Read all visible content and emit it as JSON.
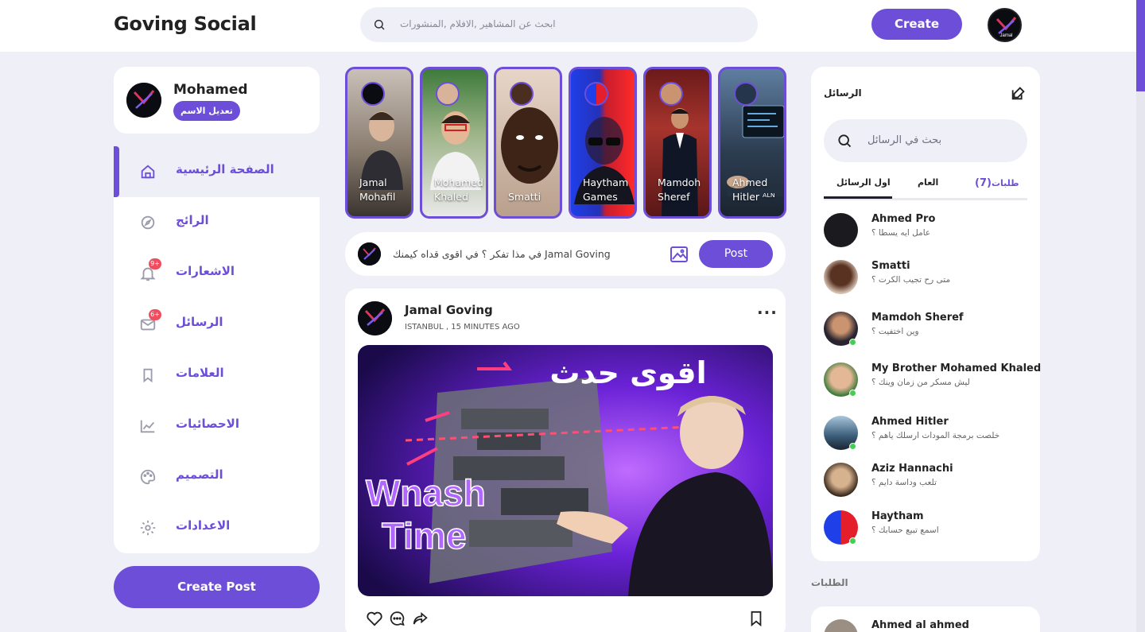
{
  "app": {
    "logo": "Goving Social",
    "accent": "#6c4ed9"
  },
  "header": {
    "search_placeholder": "ابحث عن المشاهير ,الافلام ,المنشورات",
    "create_label": "Create"
  },
  "profile": {
    "name": "Mohamed",
    "edit_label": "تعديل الاسم"
  },
  "nav": {
    "items": [
      {
        "label": "الصفحة الرئيسية",
        "icon": "home-icon",
        "badge": ""
      },
      {
        "label": "الرائج",
        "icon": "compass-icon",
        "badge": ""
      },
      {
        "label": "الاشعارات",
        "icon": "bell-icon",
        "badge": "9+"
      },
      {
        "label": "الرسائل",
        "icon": "mail-icon",
        "badge": "6+"
      },
      {
        "label": "العلامات",
        "icon": "bookmark-icon",
        "badge": ""
      },
      {
        "label": "الاحصائيات",
        "icon": "chart-icon",
        "badge": ""
      },
      {
        "label": "التصميم",
        "icon": "palette-icon",
        "badge": ""
      },
      {
        "label": "الاعدادات",
        "icon": "gear-icon",
        "badge": ""
      }
    ],
    "create_post_label": "Create Post"
  },
  "stories": [
    {
      "line1": "Jamal",
      "line2": "Mohafil"
    },
    {
      "line1": "Mohamed",
      "line2": "Khaled"
    },
    {
      "line1": "Smatti",
      "line2": ""
    },
    {
      "line1": "Haytham",
      "line2": "Games"
    },
    {
      "line1": "Mamdoh",
      "line2": "Sheref"
    },
    {
      "line1": "Ahmed",
      "line2": "Hitler ᴬᴸᴺ"
    }
  ],
  "composer": {
    "placeholder": "في مذا تفكر ؟ في اقوى قداه كيمنك Jamal Goving",
    "post_label": "Post"
  },
  "post": {
    "author": "Jamal Goving",
    "meta": "ISTANBUL , 15 MINUTES AGO",
    "more": "···",
    "image_text": {
      "headline": "اقوى حدث",
      "line1": "Wnash",
      "line2": "Time"
    }
  },
  "messages": {
    "title": "الرسائل",
    "search_placeholder": "بحث في الرسائل",
    "tabs": {
      "primary": "اول الرسائل",
      "general": "العام",
      "requests": "طلبات",
      "requests_count": "(7)"
    },
    "rows": [
      {
        "name": "Ahmed Pro",
        "text": "عامل ايه يسطا ؟",
        "online": false
      },
      {
        "name": "Smatti",
        "text": "متى رح تجيب الكرت ؟",
        "online": false
      },
      {
        "name": "Mamdoh Sheref",
        "text": "وين اختفيت ؟",
        "online": true
      },
      {
        "name": "My Brother Mohamed Khaled",
        "text": "ليش مسكر من زمان وينك ؟",
        "online": true
      },
      {
        "name": "Ahmed Hitler",
        "text": "خلصت برمجة المودات ارسلك ياهم ؟",
        "online": true
      },
      {
        "name": "Aziz Hannachi",
        "text": "تلعب وداسة دايم ؟",
        "online": false
      },
      {
        "name": "Haytham",
        "text": "اسمع تبيع حسابك ؟",
        "online": true
      }
    ]
  },
  "requests": {
    "title": "الطلبات",
    "first_name": "Ahmed al ahmed"
  }
}
